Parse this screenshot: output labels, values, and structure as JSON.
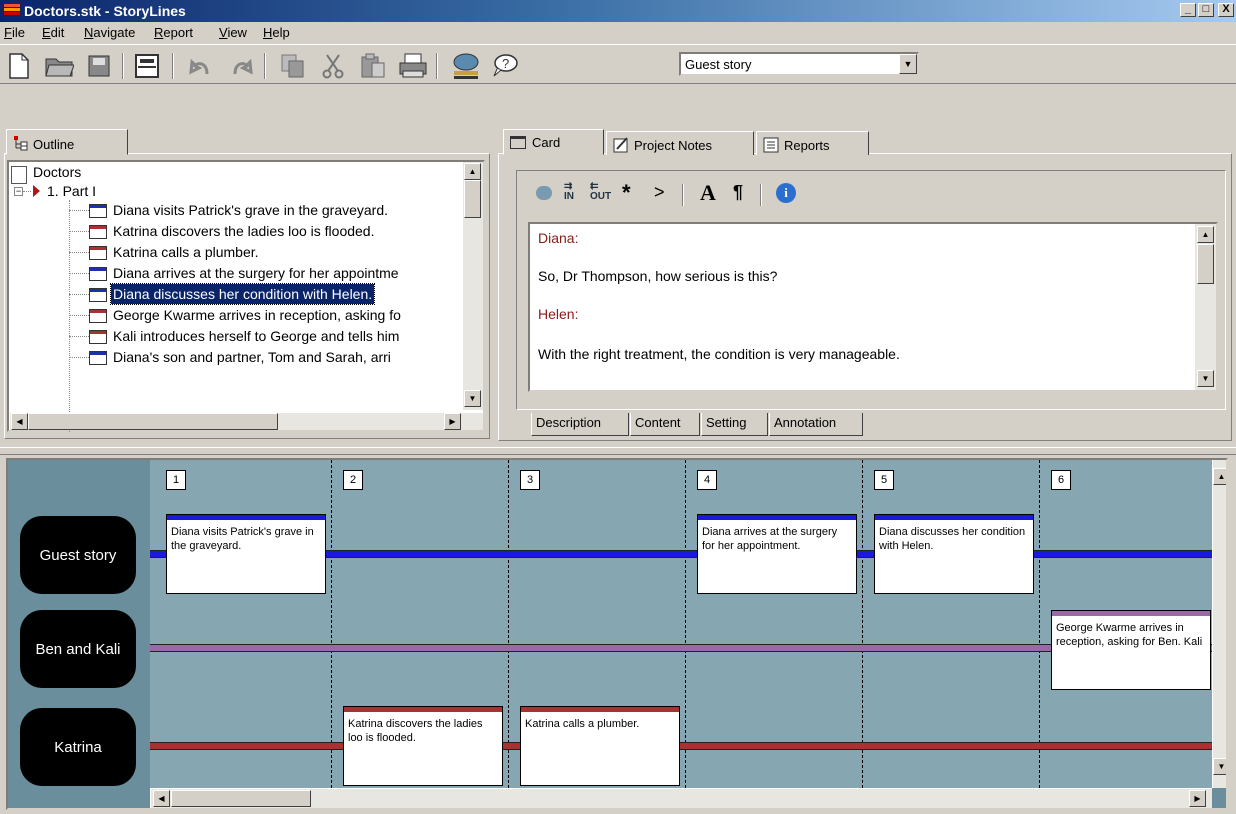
{
  "window": {
    "title": "Doctors.stk - StoryLines",
    "min": "_",
    "max": "□",
    "close": "X"
  },
  "menu": [
    "File",
    "Edit",
    "Navigate",
    "Report",
    "View",
    "Help"
  ],
  "menu_underline": [
    "F",
    "E",
    "N",
    "R",
    "V",
    "H"
  ],
  "toolbar": {
    "story_select": "Guest story"
  },
  "outline": {
    "tab": "Outline",
    "root": "Doctors",
    "part": "1. Part I",
    "items": [
      {
        "label": "Diana visits Patrick's grave in the graveyard.",
        "color": "blue"
      },
      {
        "label": "Katrina discovers the ladies loo is flooded.",
        "color": "red"
      },
      {
        "label": "Katrina calls a plumber.",
        "color": "red"
      },
      {
        "label": "Diana arrives at the surgery for her appointme",
        "color": "blue"
      },
      {
        "label": "Diana discusses her condition with Helen.",
        "color": "blue",
        "selected": true
      },
      {
        "label": "George Kwarme arrives in reception, asking fo",
        "color": "red"
      },
      {
        "label": "Kali introduces herself to George and tells him",
        "color": "red"
      },
      {
        "label": "Diana's son and partner, Tom and Sarah, arri",
        "color": "blue"
      }
    ]
  },
  "right_tabs": [
    "Card",
    "Project Notes",
    "Reports"
  ],
  "content": {
    "lines": [
      {
        "text": "Diana:",
        "speaker": true
      },
      {
        "text": "So, Dr Thompson, how serious is this?",
        "speaker": false
      },
      {
        "text": "Helen:",
        "speaker": true
      },
      {
        "text": "With the right treatment, the condition is very manageable.",
        "speaker": false
      }
    ]
  },
  "bottom_tabs": [
    "Description",
    "Content",
    "Setting",
    "Annotation"
  ],
  "timeline": {
    "lanes": [
      "Guest story",
      "Ben and Kali",
      "Katrina"
    ],
    "lane_colors": [
      "#1a1adf",
      "#9a6aa8",
      "#a83232"
    ],
    "columns": [
      "1",
      "2",
      "3",
      "4",
      "5",
      "6"
    ],
    "scenes": [
      {
        "col": 1,
        "lane": 0,
        "text": "Diana visits Patrick's grave in the graveyard."
      },
      {
        "col": 4,
        "lane": 0,
        "text": "Diana arrives at the surgery for her appointment."
      },
      {
        "col": 5,
        "lane": 0,
        "text": "Diana discusses her condition with Helen."
      },
      {
        "col": 6,
        "lane": 1,
        "text": "George Kwarme arrives in reception, asking for Ben. Kali"
      },
      {
        "col": 2,
        "lane": 2,
        "text": "Katrina discovers the ladies loo is flooded."
      },
      {
        "col": 3,
        "lane": 2,
        "text": "Katrina calls a plumber."
      }
    ]
  }
}
